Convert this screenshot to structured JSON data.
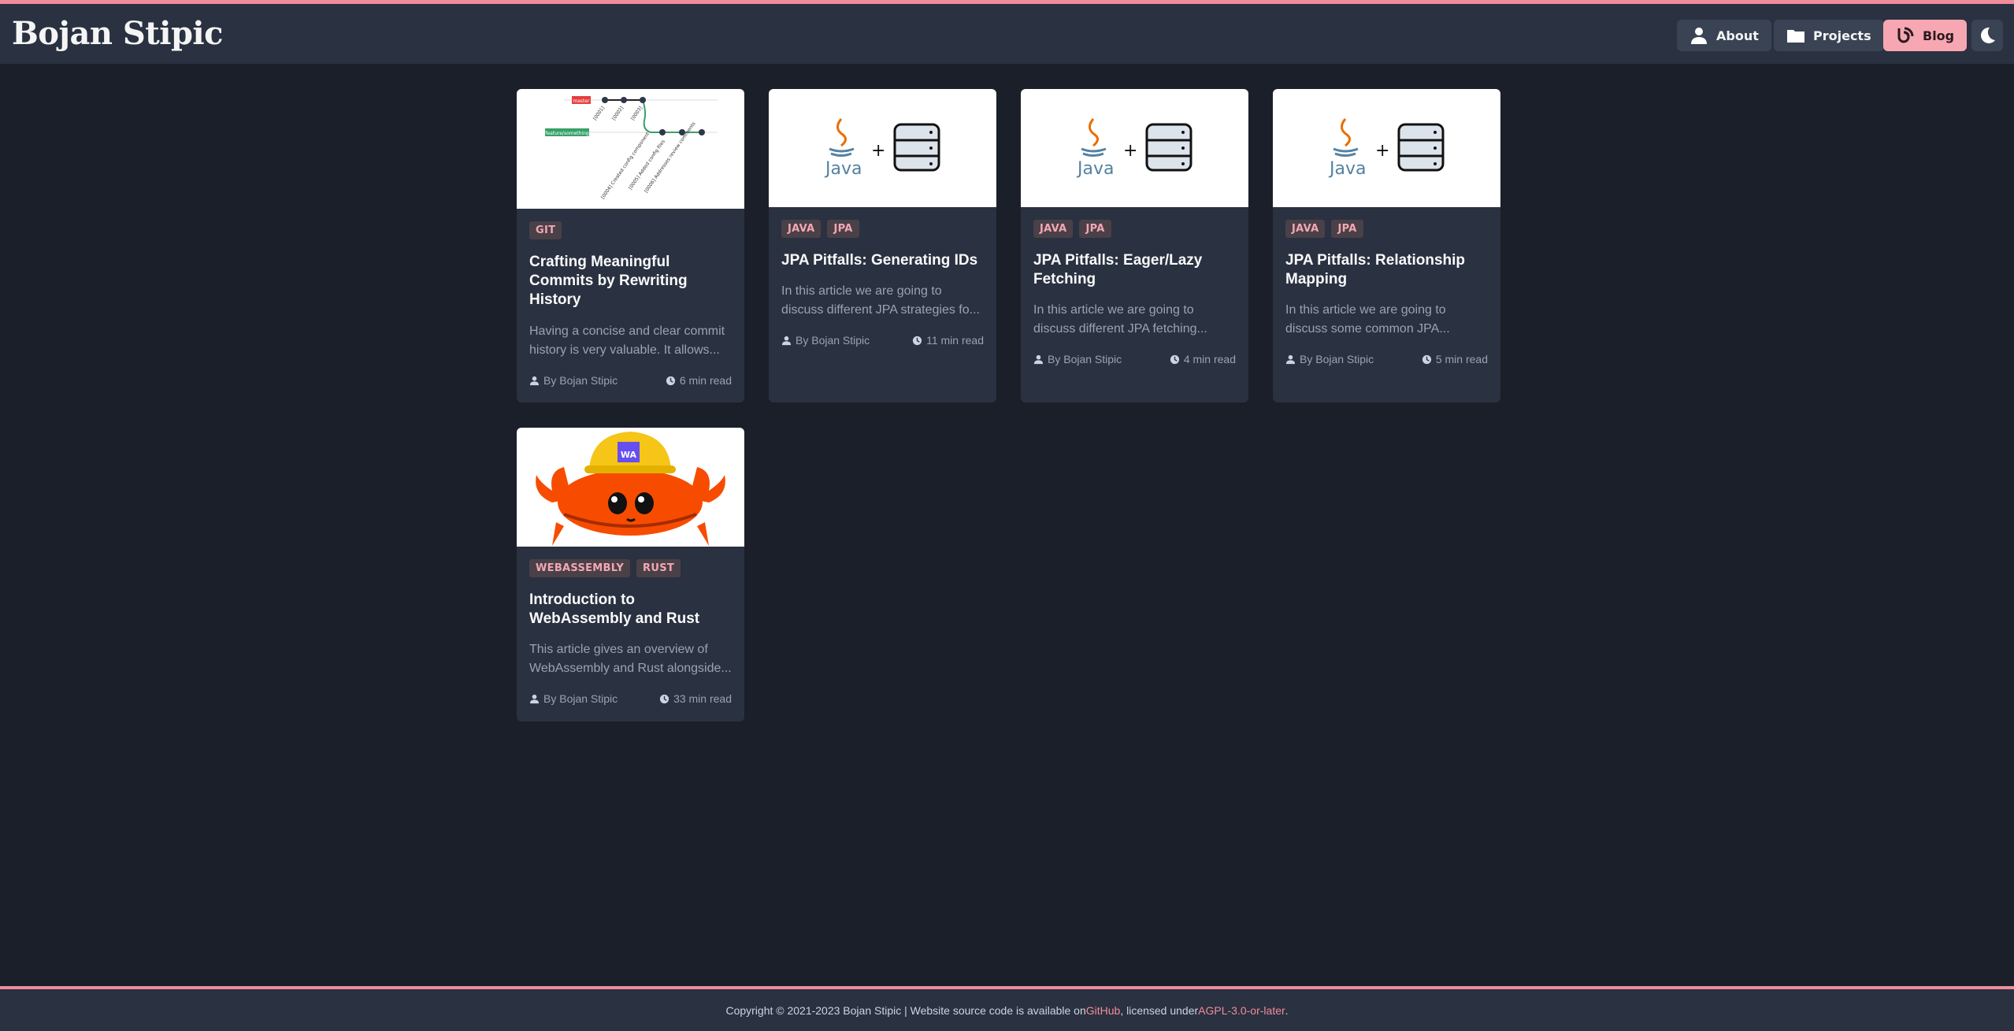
{
  "header": {
    "brand": "Bojan Stipic",
    "nav": [
      {
        "label": "About",
        "icon": "person-icon"
      },
      {
        "label": "Projects",
        "icon": "folder-icon"
      },
      {
        "label": "Blog",
        "icon": "blog-icon",
        "active": true
      }
    ],
    "theme_toggle_icon": "moon-icon"
  },
  "posts": [
    {
      "tags": [
        "GIT"
      ],
      "title": "Crafting Meaningful Commits by Rewriting History",
      "description": "Having a concise and clear commit history is very valuable. It allows...",
      "author": "By Bojan Stipic",
      "read_time": "6 min read",
      "thumbnail": {
        "labels": [
          "master",
          "feature/something",
          "[0001]",
          "[0002]",
          "[0003]",
          "[0004] Created config component",
          "[0005] Added config files",
          "[0006] Addresses review comments"
        ]
      }
    },
    {
      "tags": [
        "JAVA",
        "JPA"
      ],
      "title": "JPA Pitfalls: Generating IDs",
      "description": "In this article we are going to discuss different JPA strategies fo...",
      "author": "By Bojan Stipic",
      "read_time": "11 min read",
      "thumbnail": {
        "labels": [
          "Java",
          "+"
        ]
      }
    },
    {
      "tags": [
        "JAVA",
        "JPA"
      ],
      "title": "JPA Pitfalls: Eager/Lazy Fetching",
      "description": "In this article we are going to discuss different JPA fetching...",
      "author": "By Bojan Stipic",
      "read_time": "4 min read",
      "thumbnail": {
        "labels": [
          "Java",
          "+"
        ]
      }
    },
    {
      "tags": [
        "JAVA",
        "JPA"
      ],
      "title": "JPA Pitfalls: Relationship Mapping",
      "description": "In this article we are going to discuss some common JPA...",
      "author": "By Bojan Stipic",
      "read_time": "5 min read",
      "thumbnail": {
        "labels": [
          "Java",
          "+"
        ]
      }
    },
    {
      "tags": [
        "WEBASSEMBLY",
        "RUST"
      ],
      "title": "Introduction to WebAssembly and Rust",
      "description": "This article gives an overview of WebAssembly and Rust alongside...",
      "author": "By Bojan Stipic",
      "read_time": "33 min read",
      "thumbnail": {
        "labels": [
          "WA"
        ]
      }
    }
  ],
  "footer": {
    "text_before": "Copyright © 2021-2023 Bojan Stipic | Website source code is available on ",
    "github_link": "GitHub",
    "text_middle": ", licensed under ",
    "license_link": "AGPL-3.0-or-later",
    "text_after": "."
  },
  "colors": {
    "background": "#1b1f2a",
    "surface": "#2a3140",
    "accent": "#f18c9a",
    "active_nav": "#f7a7b2"
  }
}
